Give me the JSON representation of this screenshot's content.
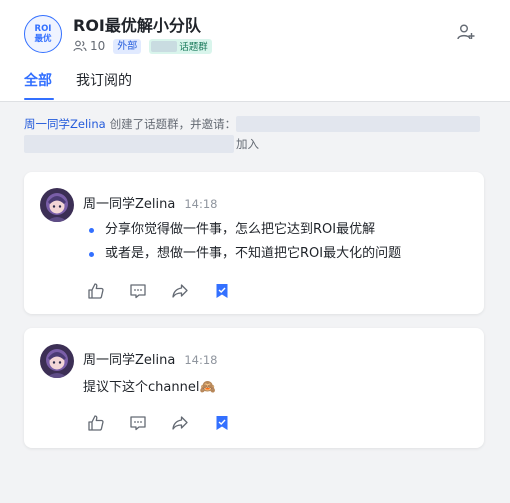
{
  "header": {
    "avatar_line1": "ROI",
    "avatar_line2": "最优",
    "title": "ROI最优解小分队",
    "member_icon": "people-icon",
    "member_count": "10",
    "external_tag": "外部",
    "topic_tag": "话题群",
    "add_member_icon": "add-person-icon"
  },
  "tabs": [
    {
      "label": "全部",
      "active": true
    },
    {
      "label": "我订阅的",
      "active": false
    }
  ],
  "system_message": {
    "user": "周一同学Zelina",
    "text": "创建了话题群，并邀请：",
    "suffix": "加入"
  },
  "messages": [
    {
      "author": "周一同学Zelina",
      "time": "14:18",
      "bullets": [
        "分享你觉得做一件事，怎么把它达到ROI最优解",
        "或者是，想做一件事，不知道把它ROI最大化的问题"
      ]
    },
    {
      "author": "周一同学Zelina",
      "time": "14:18",
      "text": "提议下这个channel🙈"
    }
  ],
  "actions": [
    "thumbs-up-icon",
    "comment-icon",
    "share-icon",
    "bookmark-icon"
  ],
  "colors": {
    "accent": "#3370ff",
    "background": "#f2f3f5",
    "tag_external_bg": "#e1eaff",
    "tag_topic_bg": "#d9f5ec"
  }
}
